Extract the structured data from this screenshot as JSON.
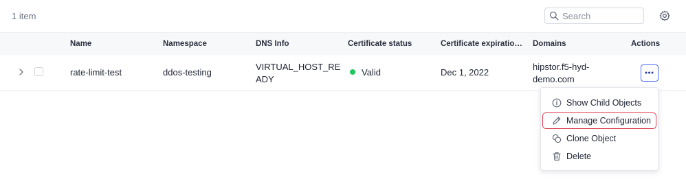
{
  "toolbar": {
    "item_count": "1 item",
    "search_placeholder": "Search"
  },
  "table": {
    "columns": [
      "Name",
      "Namespace",
      "DNS Info",
      "Certificate status",
      "Certificate expiratio…",
      "Domains",
      "Actions"
    ],
    "rows": [
      {
        "name": "rate-limit-test",
        "namespace": "ddos-testing",
        "dns_info": "VIRTUAL_HOST_READY",
        "certificate_status": "Valid",
        "certificate_expiration": "Dec 1, 2022",
        "domains": "hipstor.f5-hyd-demo.com"
      }
    ]
  },
  "menu": {
    "items": [
      {
        "label": "Show Child Objects",
        "icon": "info-circle-icon"
      },
      {
        "label": "Manage Configuration",
        "icon": "pencil-icon"
      },
      {
        "label": "Clone Object",
        "icon": "clone-icon"
      },
      {
        "label": "Delete",
        "icon": "trash-icon"
      }
    ]
  },
  "colors": {
    "status_valid": "#22c55e",
    "accent": "#4b6cf2",
    "highlight": "#e0384a"
  }
}
